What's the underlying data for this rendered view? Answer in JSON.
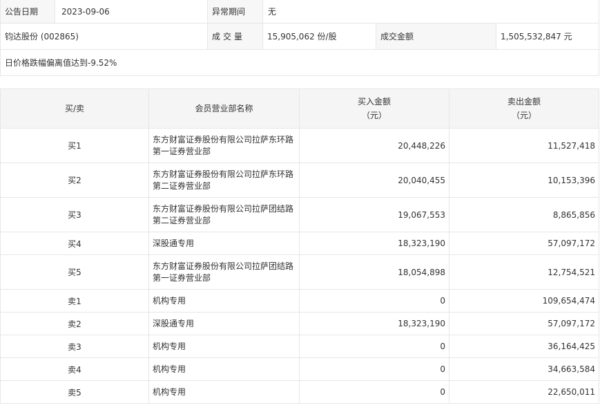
{
  "info": {
    "announce_date_label": "公告日期",
    "announce_date": "2023-09-06",
    "abnormal_period_label": "异常期间",
    "abnormal_period": "无",
    "stock": "钧达股份 (002865)",
    "volume_label": "成交量",
    "volume": "15,905,062 份/股",
    "amount_label": "成交金额",
    "amount": "1,505,532,847 元",
    "reason": "日价格跌幅偏离值达到-9.52%"
  },
  "table": {
    "headers": {
      "side": "买/卖",
      "member": "会员营业部名称",
      "buy_line1": "买入金额",
      "buy_line2": "（元）",
      "sell_line1": "卖出金额",
      "sell_line2": "（元）"
    },
    "rows": [
      {
        "side": "买1",
        "name1": "东方财富证券股份有限公司拉萨东环路",
        "name2": "第一证券营业部",
        "buy": "20,448,226",
        "sell": "11,527,418"
      },
      {
        "side": "买2",
        "name1": "东方财富证券股份有限公司拉萨东环路",
        "name2": "第二证券营业部",
        "buy": "20,040,455",
        "sell": "10,153,396"
      },
      {
        "side": "买3",
        "name1": "东方财富证券股份有限公司拉萨团结路",
        "name2": "第二证券营业部",
        "buy": "19,067,553",
        "sell": "8,865,856"
      },
      {
        "side": "买4",
        "name1": "深股通专用",
        "name2": "",
        "buy": "18,323,190",
        "sell": "57,097,172"
      },
      {
        "side": "买5",
        "name1": "东方财富证券股份有限公司拉萨团结路",
        "name2": "第一证券营业部",
        "buy": "18,054,898",
        "sell": "12,754,521"
      },
      {
        "side": "卖1",
        "name1": "机构专用",
        "name2": "",
        "buy": "0",
        "sell": "109,654,474"
      },
      {
        "side": "卖2",
        "name1": "深股通专用",
        "name2": "",
        "buy": "18,323,190",
        "sell": "57,097,172"
      },
      {
        "side": "卖3",
        "name1": "机构专用",
        "name2": "",
        "buy": "0",
        "sell": "36,164,425"
      },
      {
        "side": "卖4",
        "name1": "机构专用",
        "name2": "",
        "buy": "0",
        "sell": "34,663,584"
      },
      {
        "side": "卖5",
        "name1": "机构专用",
        "name2": "",
        "buy": "0",
        "sell": "22,650,011"
      }
    ]
  }
}
